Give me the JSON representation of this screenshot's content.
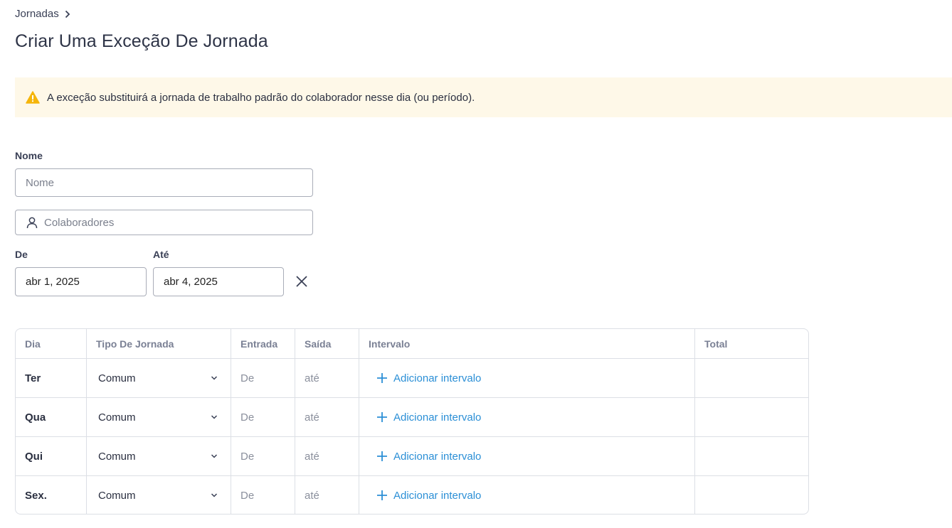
{
  "breadcrumb": {
    "label": "Jornadas"
  },
  "page": {
    "title": "Criar Uma Exceção De Jornada"
  },
  "alert": {
    "text": "A exceção substituirá a jornada de trabalho padrão do colaborador nesse dia (ou período)."
  },
  "form": {
    "name_label": "Nome",
    "name_placeholder": "Nome",
    "collaborators_placeholder": "Colaboradores",
    "from_label": "De",
    "from_value": "abr 1, 2025",
    "to_label": "Até",
    "to_value": "abr 4, 2025"
  },
  "table": {
    "headers": [
      "Dia",
      "Tipo De Jornada",
      "Entrada",
      "Saída",
      "Intervalo",
      "Total"
    ],
    "rows": [
      {
        "day": "Ter",
        "type": "Comum",
        "entry": "De",
        "exit": "até",
        "interval": "Adicionar intervalo",
        "total": ""
      },
      {
        "day": "Qua",
        "type": "Comum",
        "entry": "De",
        "exit": "até",
        "interval": "Adicionar intervalo",
        "total": ""
      },
      {
        "day": "Qui",
        "type": "Comum",
        "entry": "De",
        "exit": "até",
        "interval": "Adicionar intervalo",
        "total": ""
      },
      {
        "day": "Sex.",
        "type": "Comum",
        "entry": "De",
        "exit": "até",
        "interval": "Adicionar intervalo",
        "total": ""
      }
    ]
  },
  "icons": {
    "breadcrumb": "chevron-right-icon",
    "alert": "warning-icon",
    "collaborators": "user-icon",
    "clear": "close-icon",
    "select": "chevron-down-icon",
    "add": "plus-icon"
  },
  "colors": {
    "alert_background": "#fef8e8",
    "warning": "#f5b50a",
    "link": "#2b8fd6",
    "border": "#dcdfe5"
  }
}
